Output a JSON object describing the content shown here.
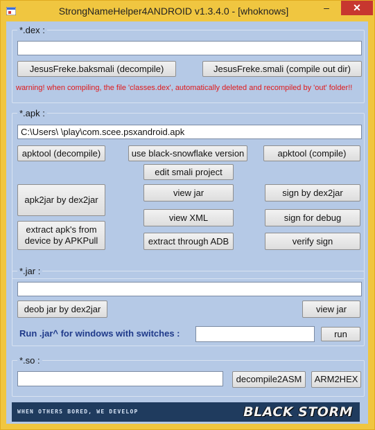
{
  "window": {
    "title": "StrongNameHelper4ANDROID v1.3.4.0 - [whoknows]",
    "minimize_glyph": "–",
    "maximize_glyph": "□",
    "close_glyph": "✕"
  },
  "dex_group": {
    "label": "*.dex :",
    "path_value": "",
    "baksmali_label": "JesusFreke.baksmali (decompile)",
    "smali_label": "JesusFreke.smali (compile out dir)",
    "warning": "warning! when compiling, the file 'classes.dex', automatically deleted and recompiled by 'out' folder!!"
  },
  "apk_group": {
    "label": "*.apk :",
    "path_value": "C:\\Users\\        \\play\\com.scee.psxandroid.apk",
    "apktool_decompile_label": "apktool (decompile)",
    "black_snowflake_label": "use black-snowflake version",
    "apktool_compile_label": "apktool (compile)",
    "edit_smali_label": "edit smali project",
    "apk2jar_label": "apk2jar by dex2jar",
    "view_jar_label": "view jar",
    "sign_dex2jar_label": "sign by dex2jar",
    "view_xml_label": "view XML",
    "sign_debug_label": "sign for debug",
    "extract_apkpull_label": "extract apk's from device by APKPull",
    "extract_adb_label": "extract through ADB",
    "verify_sign_label": "verify sign"
  },
  "jar_group": {
    "label": "*.jar :",
    "path_value": "",
    "deob_label": "deob jar by dex2jar",
    "view_jar_label": "view jar",
    "run_label": "Run .jar^ for windows with switches :",
    "switches_value": "",
    "run_button_label": "run"
  },
  "so_group": {
    "label": "*.so :",
    "path_value": "",
    "decompile2asm_label": "decompile2ASM",
    "arm2hex_label": "ARM2HEX"
  },
  "banner": {
    "tagline": "when others bored, we develop",
    "logo": "BLACK STORM"
  },
  "colors": {
    "titlebar": "#f0c640",
    "client_bg": "#b5c9e6",
    "warning": "#e0191b",
    "run_label": "#1f3a8a",
    "banner_bg": "#1f3b5e",
    "close_button": "#c7372f"
  }
}
